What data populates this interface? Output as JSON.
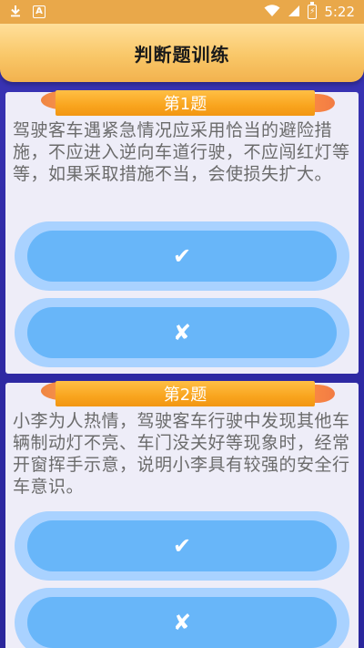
{
  "status_bar": {
    "time": "5:22",
    "icons": [
      "download-icon",
      "a-icon",
      "wifi-icon",
      "signal-icon",
      "battery-charging-icon"
    ]
  },
  "header": {
    "title": "判断题训练"
  },
  "questions": [
    {
      "label": "第1题",
      "text": "驾驶客车遇紧急情况应采用恰当的避险措施，不应进入逆向车道行驶，不应闯红灯等等，如果采取措施不当，会使损失扩大。",
      "true_icon": "✔",
      "false_icon": "✘"
    },
    {
      "label": "第2题",
      "text": "小李为人热情，驾驶客车行驶中发现其他车辆制动灯不亮、车门没关好等现象时，经常开窗挥手示意，说明小李具有较强的安全行车意识。",
      "true_icon": "✔",
      "false_icon": "✘"
    }
  ],
  "colors": {
    "header": "#f9c768",
    "background": "#2f2aa6",
    "ribbon": "#f9a51e",
    "button_outer": "#a9d2ff",
    "button_inner": "#68b6f9"
  }
}
